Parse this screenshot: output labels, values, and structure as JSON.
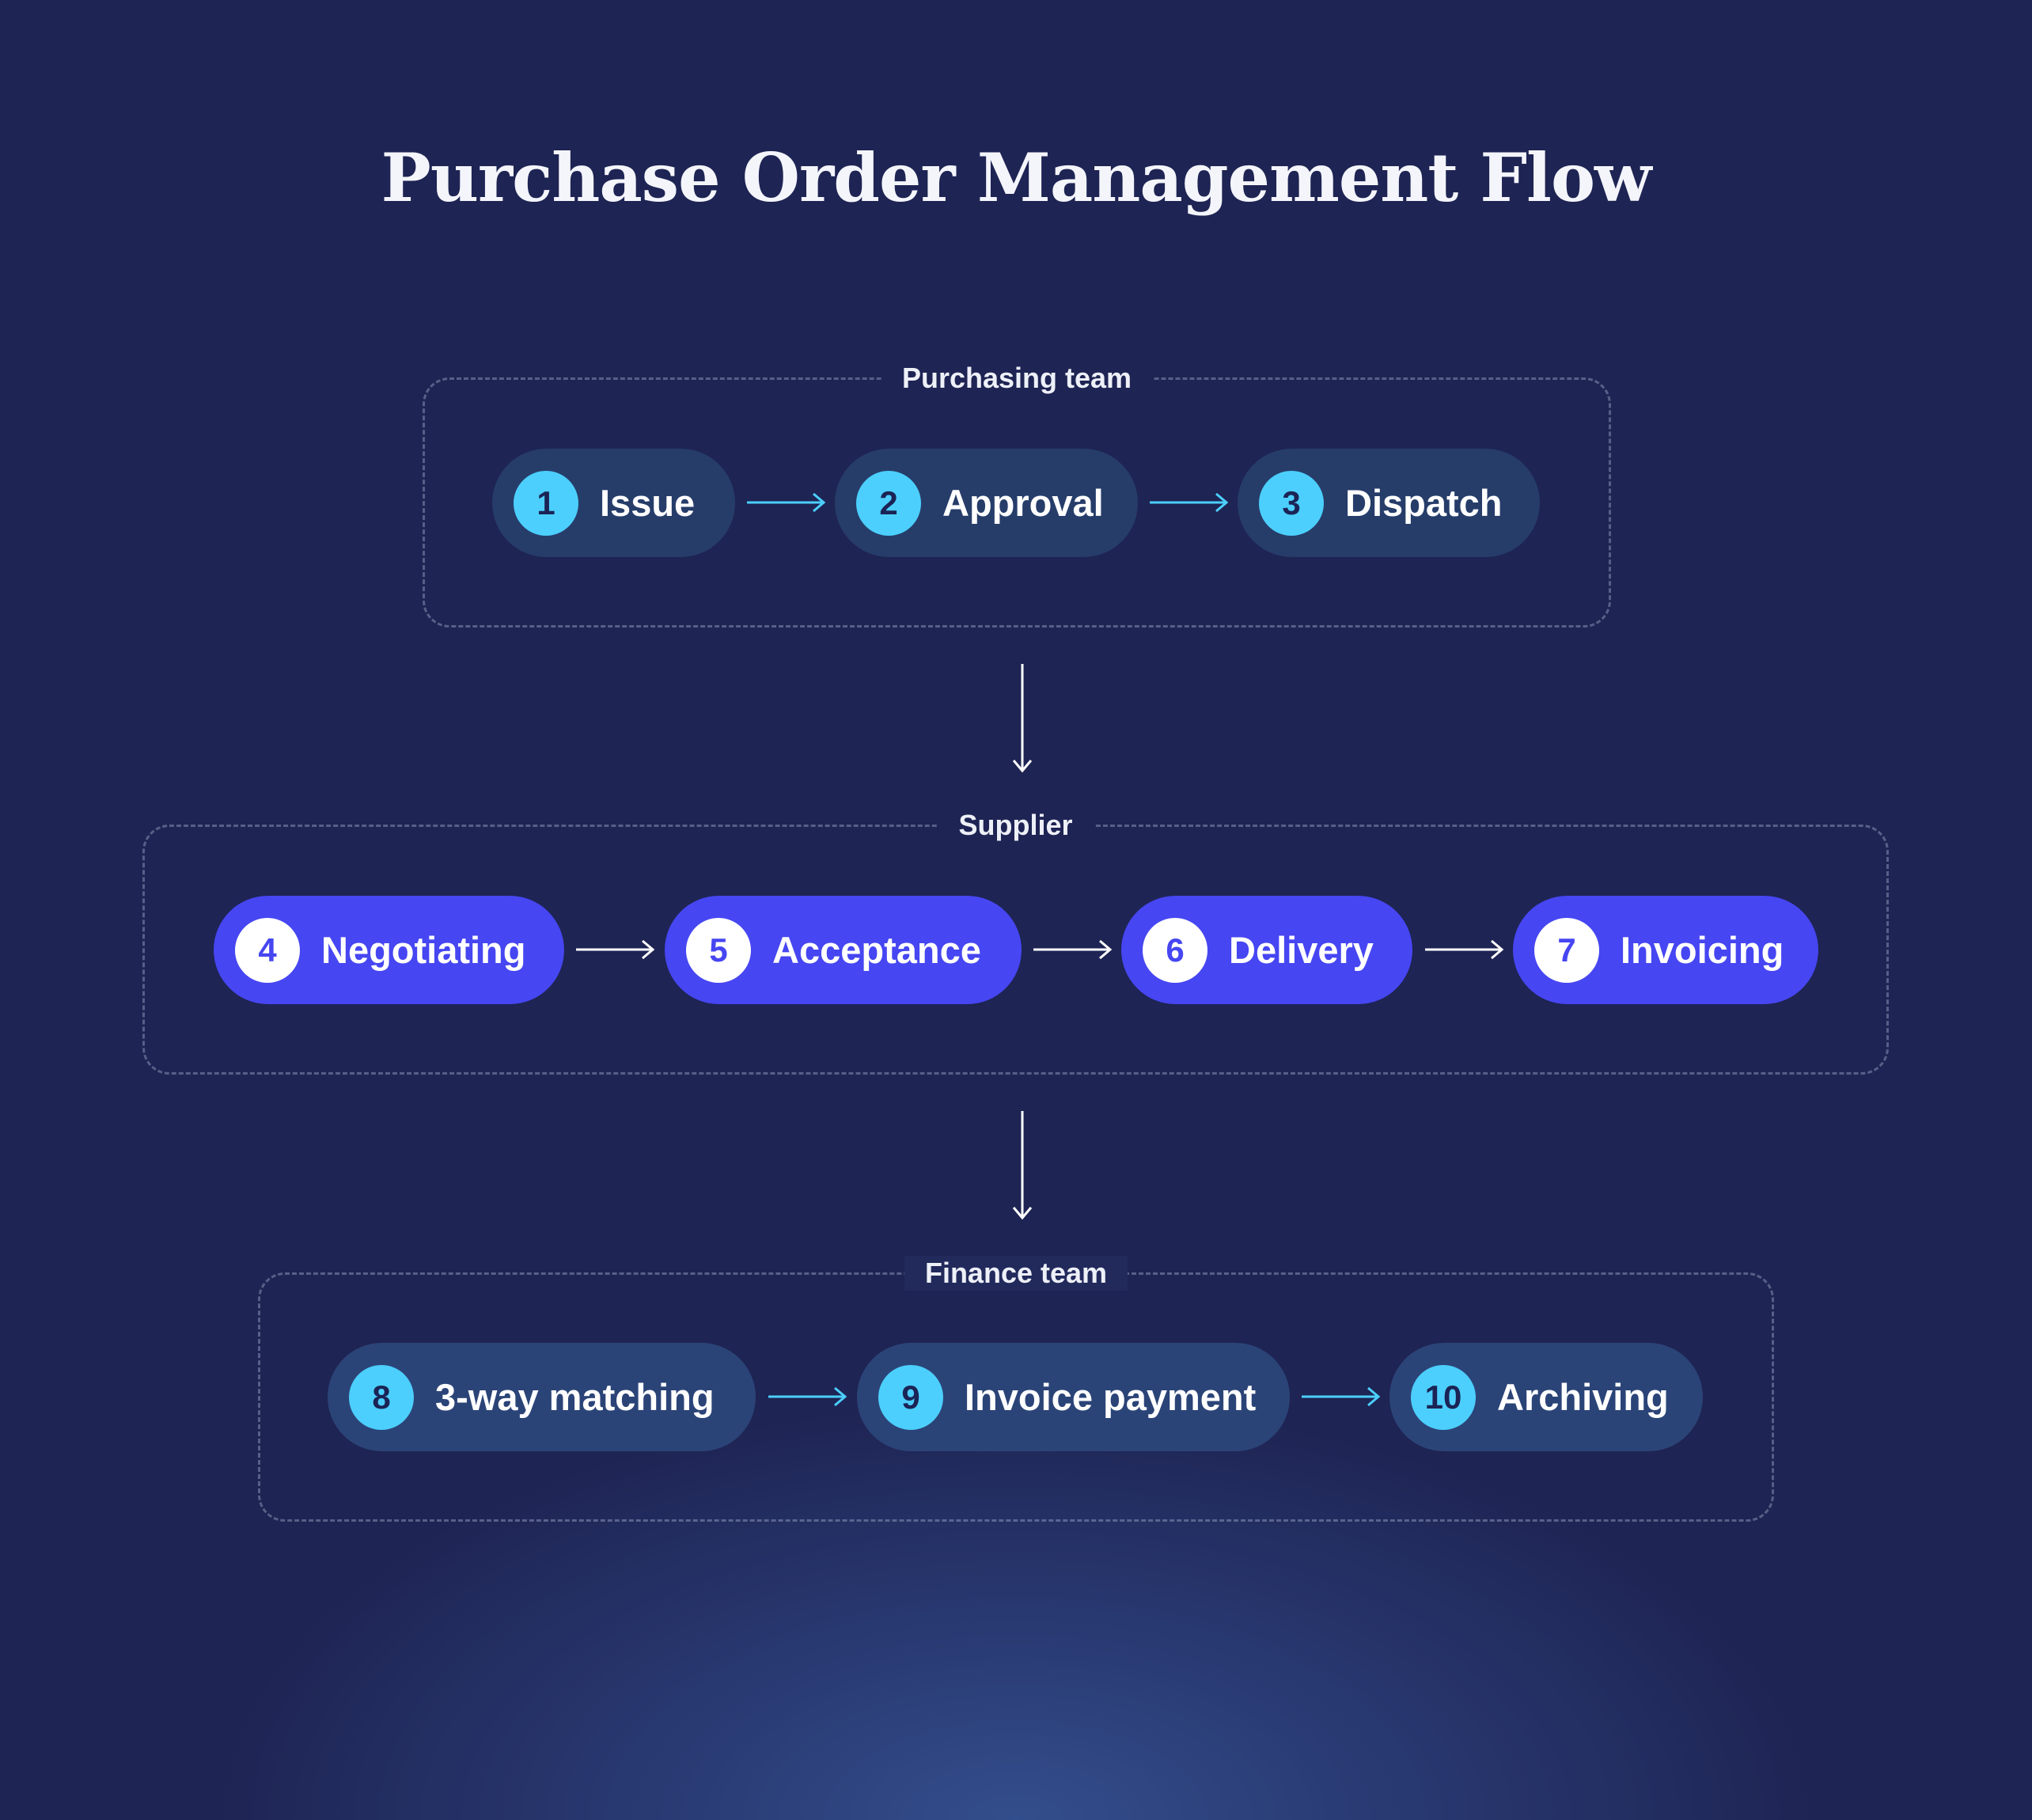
{
  "title": "Purchase Order Management Flow",
  "colors": {
    "background": "#1e2453",
    "internal_step": "#263d6a",
    "supplier_step": "#4646f2",
    "badge_cyan": "#4ccffd",
    "arrow_cyan": "#4ccffd",
    "arrow_white": "#ffffff"
  },
  "groups": [
    {
      "label": "Purchasing team",
      "steps": [
        {
          "number": "1",
          "label": "Issue"
        },
        {
          "number": "2",
          "label": "Approval"
        },
        {
          "number": "3",
          "label": "Dispatch"
        }
      ]
    },
    {
      "label": "Supplier",
      "steps": [
        {
          "number": "4",
          "label": "Negotiating"
        },
        {
          "number": "5",
          "label": "Acceptance"
        },
        {
          "number": "6",
          "label": "Delivery"
        },
        {
          "number": "7",
          "label": "Invoicing"
        }
      ]
    },
    {
      "label": "Finance team",
      "steps": [
        {
          "number": "8",
          "label": "3-way matching"
        },
        {
          "number": "9",
          "label": "Invoice payment"
        },
        {
          "number": "10",
          "label": "Archiving"
        }
      ]
    }
  ]
}
